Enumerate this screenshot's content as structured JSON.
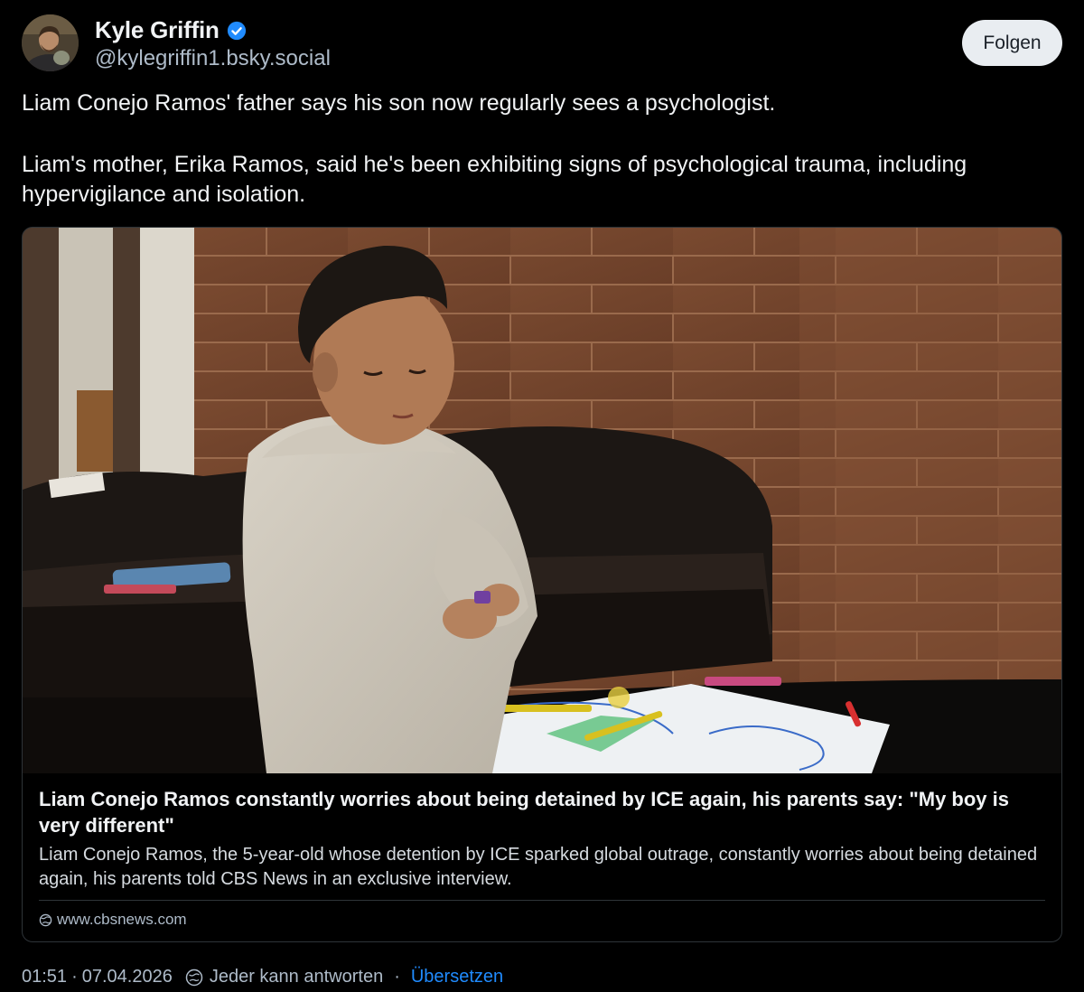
{
  "author": {
    "display_name": "Kyle Griffin",
    "handle": "@kylegriffin1.bsky.social",
    "verified": true,
    "avatar_icon": "avatar"
  },
  "follow_label": "Folgen",
  "post_text": [
    "Liam Conejo Ramos' father says his son now regularly sees a psychologist.",
    "Liam's mother, Erika Ramos, said he's been exhibiting signs of psychological trauma, including hypervigilance and isolation."
  ],
  "link_card": {
    "title": "Liam Conejo Ramos constantly worries about being detained by ICE again, his parents say: \"My boy is very different\"",
    "description": "Liam Conejo Ramos, the 5-year-old whose detention by ICE sparked global outrage, constantly worries about being detained again, his parents told CBS News in an exclusive interview.",
    "domain": "www.cbsnews.com",
    "domain_icon": "globe-icon"
  },
  "footer": {
    "time": "01:51",
    "separator": "·",
    "date": "07.04.2026",
    "reply_setting": "Jeder kann antworten",
    "reply_icon": "reply-settings-icon",
    "translate_label": "Übersetzen"
  },
  "colors": {
    "background": "#000000",
    "text_primary": "#f1f3f5",
    "text_secondary": "#aebbc9",
    "link_blue": "#208bfe",
    "verified_blue": "#208bfe",
    "follow_button_bg": "#e9edf1",
    "card_border": "#2e3438"
  }
}
